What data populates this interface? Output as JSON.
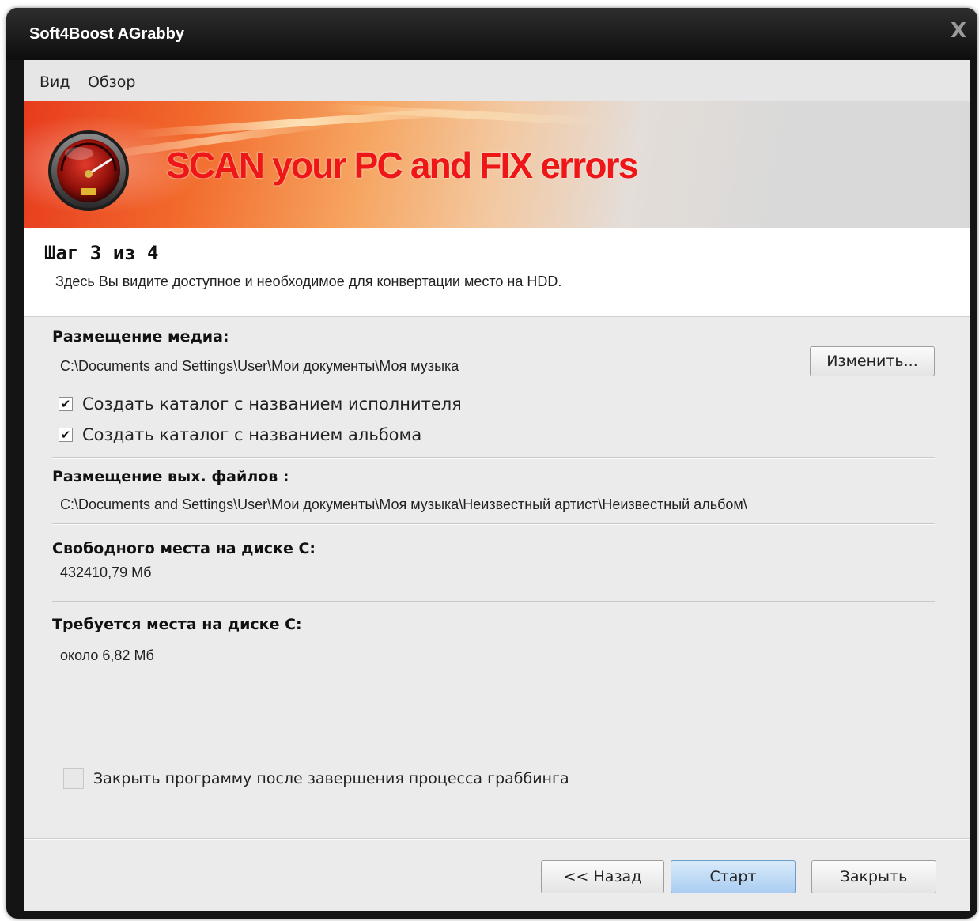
{
  "window": {
    "title": "Soft4Boost AGrabby",
    "close_symbol": "X"
  },
  "menu": {
    "items": [
      "Вид",
      "Обзор"
    ]
  },
  "banner": {
    "text": "SCAN your PC and FIX errors"
  },
  "step": {
    "title": "Шаг 3 из 4",
    "description": "Здесь Вы видите доступное и необходимое для конвертации место на HDD."
  },
  "media": {
    "label": "Размещение медиа:",
    "path": "C:\\Documents and Settings\\User\\Мои документы\\Моя музыка",
    "change_button": "Изменить...",
    "checkbox_artist": {
      "label": "Создать каталог с названием исполнителя",
      "checked": true
    },
    "checkbox_album": {
      "label": "Создать каталог с названием альбома",
      "checked": true
    }
  },
  "output": {
    "label": "Размещение вых. файлов :",
    "path": "C:\\Documents and Settings\\User\\Мои документы\\Моя музыка\\Неизвестный артист\\Неизвестный альбом\\"
  },
  "free_space": {
    "label": "Свободного места на диске С:",
    "value": "432410,79 Мб"
  },
  "required_space": {
    "label": "Требуется места на диске С:",
    "value": "около 6,82 Мб"
  },
  "close_after": {
    "label": "Закрыть программу после завершения процесса граббинга",
    "checked": false
  },
  "buttons": {
    "back": "<< Назад",
    "start": "Старт",
    "close": "Закрыть"
  },
  "check_mark": "✔"
}
